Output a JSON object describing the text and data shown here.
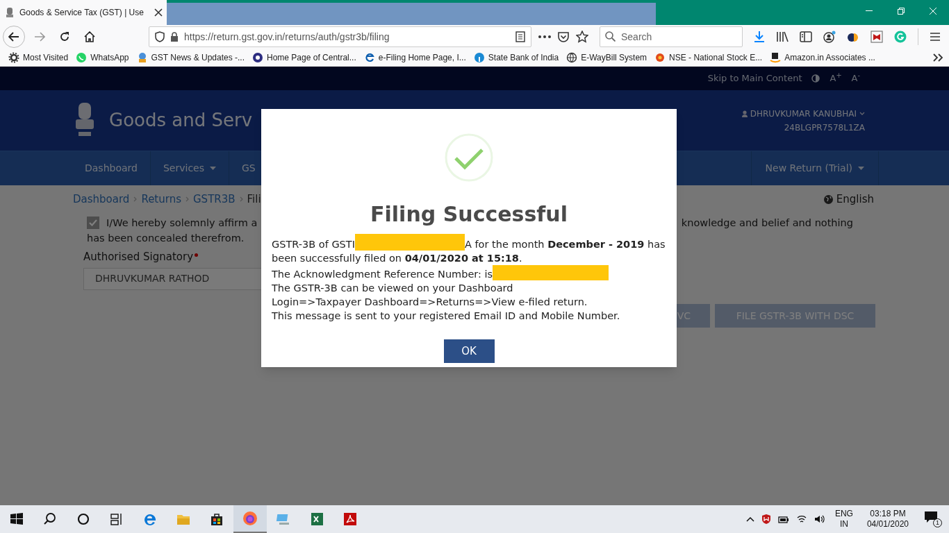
{
  "browser": {
    "tabs": [
      {
        "title": "Goods & Service Tax (GST) | Use",
        "selected": true
      }
    ],
    "url": "https://return.gst.gov.in/returns/auth/gstr3b/filing",
    "search": {
      "placeholder": "Search"
    },
    "bookmarks": [
      "Most Visited",
      "WhatsApp",
      "GST News & Updates -...",
      "Home Page of Central...",
      "e-Filing Home Page, I...",
      "State Bank of India",
      "E-WayBill System",
      "NSE - National Stock E...",
      "Amazon.in Associates ..."
    ]
  },
  "site": {
    "skip_link": "Skip to Main Content",
    "font_larger": "A$^{+}$",
    "font_smaller": "A$^{-}$",
    "title": "Goods and Serv",
    "user_name": "DHRUVKUMAR KANUBHAI",
    "gstin": "24BLGPR7578L1ZA",
    "nav_left": [
      {
        "label": "Dashboard"
      },
      {
        "label": "Services",
        "dropdown": true
      },
      {
        "label": "GS"
      }
    ],
    "nav_right": [
      {
        "label": "New Return (Trial)",
        "dropdown": true
      }
    ],
    "breadcrumb": [
      "Dashboard",
      "Returns",
      "GSTR3B",
      "Fili"
    ],
    "language": "English",
    "declaration": {
      "checked": true,
      "text_left": "I/We hereby solemnly affirm a",
      "text_right": "knowledge and belief and nothing",
      "text_line2": "has been concealed therefrom."
    },
    "signatory": {
      "label": "Authorised Signatory",
      "required": true,
      "value": "DHRUVKUMAR RATHOD"
    },
    "buttons": [
      "VC",
      "FILE GSTR-3B WITH DSC"
    ]
  },
  "dialog": {
    "title": "Filing Successful",
    "line1_before": "GSTR-3B of GSTI",
    "line1_after": "A for the month **December - 2019** has",
    "line1_continued": "been successfully filed on **04/01/2020 at 15:18**.",
    "line2": "The Acknowledgment Reference Number: is",
    "line3": "The GSTR-3B can be viewed on your Dashboard Login=>Taxpayer Dashboard=>Returns=>View e-filed return.",
    "line4": "This message is sent to your registered Email ID and Mobile Number.",
    "ok": "OK"
  },
  "taskbar": {
    "language": "ENG",
    "region": "IN",
    "time": "03:18 PM",
    "date": "04/01/2020",
    "notifications": "1"
  }
}
